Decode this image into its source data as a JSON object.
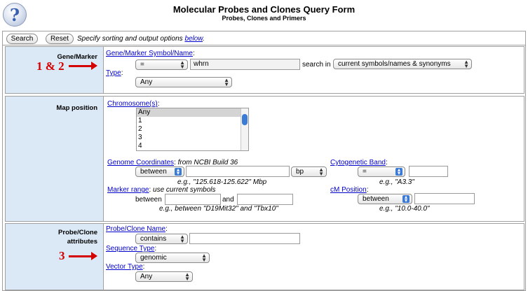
{
  "header": {
    "help_icon": "question-mark-icon",
    "help_glyph": "?",
    "title": "Molecular Probes and Clones Query Form",
    "subtitle": "Probes, Clones and Primers"
  },
  "toolbar": {
    "search_label": "Search",
    "reset_label": "Reset",
    "hint_text": "Specify sorting and output options ",
    "hint_link": "below",
    "hint_end": "."
  },
  "gene_marker": {
    "row_label": "Gene/Marker",
    "field_label": "Gene/Marker Symbol/Name",
    "operator": "=",
    "value": "whrn",
    "search_in_label": "search in",
    "search_in": "current symbols/names & synonyms",
    "type_label": "Type",
    "type_value": "Any"
  },
  "map_position": {
    "row_label": "Map position",
    "chromosome_label": "Chromosome(s)",
    "chromosomes": [
      "Any",
      "1",
      "2",
      "3",
      "4"
    ],
    "coords_label": "Genome Coordinates",
    "coords_note": "from NCBI Build 36",
    "coords_operator": "between",
    "coords_value": "",
    "coords_unit": "bp",
    "coords_example": "e.g., \"125.618-125.622\" Mbp",
    "cyto_label": "Cytogenetic Band",
    "cyto_operator": "=",
    "cyto_example": "e.g., \"A3.3\"",
    "marker_range_label": "Marker range",
    "marker_range_note": "use current symbols",
    "between_text": "between",
    "and_text": "and",
    "marker_example": "e.g., between \"D19Mit32\" and \"Tbx10\"",
    "cm_label": "cM Position",
    "cm_operator": "between",
    "cm_example": "e.g., \"10.0-40.0\""
  },
  "probe_clone": {
    "row_label_line1": "Probe/Clone",
    "row_label_line2": "attributes",
    "name_label": "Probe/Clone Name",
    "name_operator": "contains",
    "seq_type_label": "Sequence Type",
    "seq_type_value": "genomic",
    "vector_label": "Vector Type",
    "vector_value": "Any"
  },
  "annotations": {
    "first": "1 & 2",
    "second": "3"
  }
}
